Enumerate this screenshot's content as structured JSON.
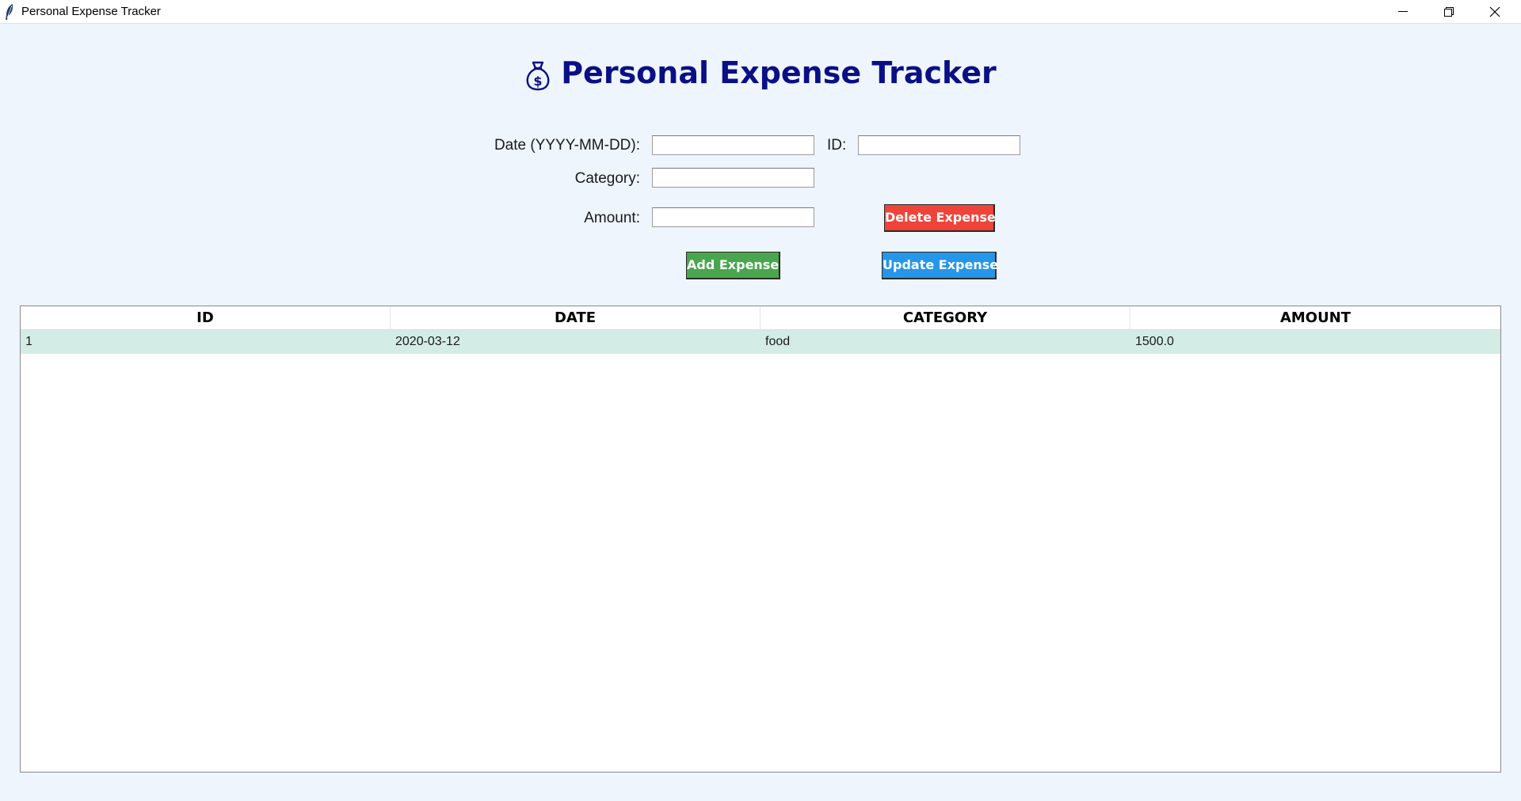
{
  "window": {
    "title": "Personal Expense Tracker",
    "icon": "feather-icon"
  },
  "header": {
    "icon": "money-bag-icon",
    "title": "Personal Expense Tracker"
  },
  "form": {
    "date_label": "Date (YYYY-MM-DD):",
    "date_value": "",
    "id_label": "ID:",
    "id_value": "",
    "category_label": "Category:",
    "category_value": "",
    "amount_label": "Amount:",
    "amount_value": ""
  },
  "buttons": {
    "delete_label": "Delete Expense",
    "add_label": "Add Expense",
    "update_label": "Update Expense",
    "delete_color": "#f0433a",
    "add_color": "#4aa64e",
    "update_color": "#2596e8"
  },
  "table": {
    "columns": [
      "ID",
      "DATE",
      "CATEGORY",
      "AMOUNT"
    ],
    "rows": [
      [
        "1",
        "2020-03-12",
        "food",
        "1500.0"
      ]
    ],
    "row_color": "#d3ece6"
  },
  "colors": {
    "background": "#eef5fd",
    "title": "#0b0f86"
  }
}
